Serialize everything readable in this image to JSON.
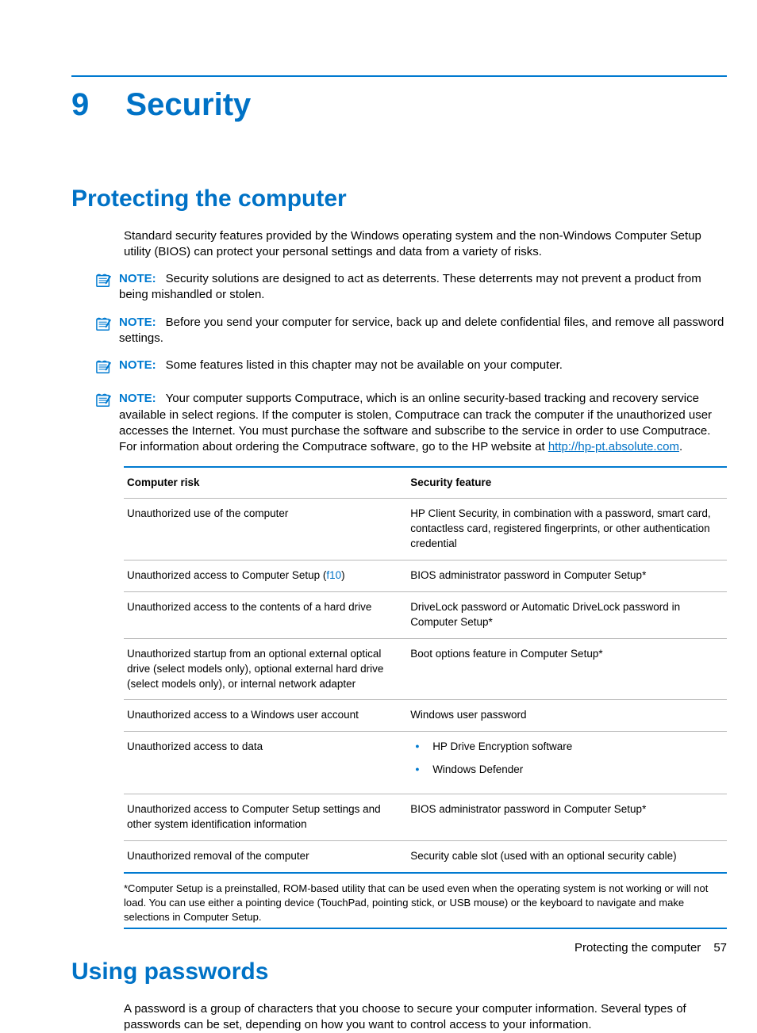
{
  "chapter": {
    "number": "9",
    "title": "Security"
  },
  "section1": {
    "title": "Protecting the computer",
    "intro": "Standard security features provided by the Windows operating system and the non-Windows Computer Setup utility (BIOS) can protect your personal settings and data from a variety of risks.",
    "notes": [
      {
        "label": "NOTE:",
        "text": "Security solutions are designed to act as deterrents. These deterrents may not prevent a product from being mishandled or stolen."
      },
      {
        "label": "NOTE:",
        "text": "Before you send your computer for service, back up and delete confidential files, and remove all password settings."
      },
      {
        "label": "NOTE:",
        "text": "Some features listed in this chapter may not be available on your computer."
      },
      {
        "label": "NOTE:",
        "text_pre": "Your computer supports Computrace, which is an online security-based tracking and recovery service available in select regions. If the computer is stolen, Computrace can track the computer if the unauthorized user accesses the Internet. You must purchase the software and subscribe to the service in order to use Computrace. For information about ordering the Computrace software, go to the HP website at ",
        "link": "http://hp-pt.absolute.com",
        "text_post": "."
      }
    ]
  },
  "table": {
    "headers": {
      "col1": "Computer risk",
      "col2": "Security feature"
    },
    "rows": [
      {
        "risk": "Unauthorized use of the computer",
        "feature": "HP Client Security, in combination with a password, smart card, contactless card, registered fingerprints, or other authentication credential"
      },
      {
        "risk_pre": "Unauthorized access to Computer Setup (",
        "risk_f10": "f10",
        "risk_post": ")",
        "feature": "BIOS administrator password in Computer Setup*"
      },
      {
        "risk": "Unauthorized access to the contents of a hard drive",
        "feature": "DriveLock password or Automatic DriveLock password in Computer Setup*"
      },
      {
        "risk": "Unauthorized startup from an optional external optical drive (select models only), optional external hard drive (select models only), or internal network adapter",
        "feature": "Boot options feature in Computer Setup*"
      },
      {
        "risk": "Unauthorized access to a Windows user account",
        "feature": "Windows user password"
      },
      {
        "risk": "Unauthorized access to data",
        "feature_list": [
          "HP Drive Encryption software",
          "Windows Defender"
        ]
      },
      {
        "risk": "Unauthorized access to Computer Setup settings and other system identification information",
        "feature": "BIOS administrator password in Computer Setup*"
      },
      {
        "risk": "Unauthorized removal of the computer",
        "feature": "Security cable slot (used with an optional security cable)"
      }
    ],
    "footnote": "*Computer Setup is a preinstalled, ROM-based utility that can be used even when the operating system is not working or will not load. You can use either a pointing device (TouchPad, pointing stick, or USB mouse) or the keyboard to navigate and make selections in Computer Setup."
  },
  "section2": {
    "title": "Using passwords",
    "para": "A password is a group of characters that you choose to secure your computer information. Several types of passwords can be set, depending on how you want to control access to your information."
  },
  "footer": {
    "text": "Protecting the computer",
    "page": "57"
  }
}
